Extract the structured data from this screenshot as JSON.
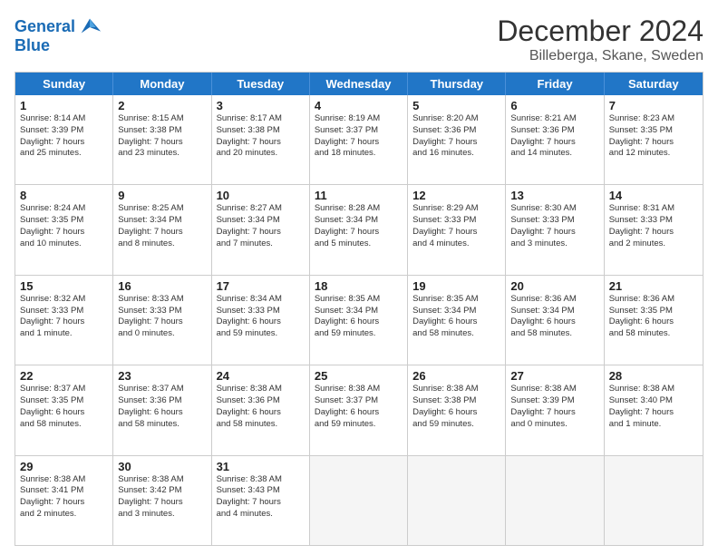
{
  "header": {
    "logo_line1": "General",
    "logo_line2": "Blue",
    "month_title": "December 2024",
    "subtitle": "Billeberga, Skane, Sweden"
  },
  "days_of_week": [
    "Sunday",
    "Monday",
    "Tuesday",
    "Wednesday",
    "Thursday",
    "Friday",
    "Saturday"
  ],
  "weeks": [
    [
      {
        "day": "1",
        "lines": [
          "Sunrise: 8:14 AM",
          "Sunset: 3:39 PM",
          "Daylight: 7 hours",
          "and 25 minutes."
        ]
      },
      {
        "day": "2",
        "lines": [
          "Sunrise: 8:15 AM",
          "Sunset: 3:38 PM",
          "Daylight: 7 hours",
          "and 23 minutes."
        ]
      },
      {
        "day": "3",
        "lines": [
          "Sunrise: 8:17 AM",
          "Sunset: 3:38 PM",
          "Daylight: 7 hours",
          "and 20 minutes."
        ]
      },
      {
        "day": "4",
        "lines": [
          "Sunrise: 8:19 AM",
          "Sunset: 3:37 PM",
          "Daylight: 7 hours",
          "and 18 minutes."
        ]
      },
      {
        "day": "5",
        "lines": [
          "Sunrise: 8:20 AM",
          "Sunset: 3:36 PM",
          "Daylight: 7 hours",
          "and 16 minutes."
        ]
      },
      {
        "day": "6",
        "lines": [
          "Sunrise: 8:21 AM",
          "Sunset: 3:36 PM",
          "Daylight: 7 hours",
          "and 14 minutes."
        ]
      },
      {
        "day": "7",
        "lines": [
          "Sunrise: 8:23 AM",
          "Sunset: 3:35 PM",
          "Daylight: 7 hours",
          "and 12 minutes."
        ]
      }
    ],
    [
      {
        "day": "8",
        "lines": [
          "Sunrise: 8:24 AM",
          "Sunset: 3:35 PM",
          "Daylight: 7 hours",
          "and 10 minutes."
        ]
      },
      {
        "day": "9",
        "lines": [
          "Sunrise: 8:25 AM",
          "Sunset: 3:34 PM",
          "Daylight: 7 hours",
          "and 8 minutes."
        ]
      },
      {
        "day": "10",
        "lines": [
          "Sunrise: 8:27 AM",
          "Sunset: 3:34 PM",
          "Daylight: 7 hours",
          "and 7 minutes."
        ]
      },
      {
        "day": "11",
        "lines": [
          "Sunrise: 8:28 AM",
          "Sunset: 3:34 PM",
          "Daylight: 7 hours",
          "and 5 minutes."
        ]
      },
      {
        "day": "12",
        "lines": [
          "Sunrise: 8:29 AM",
          "Sunset: 3:33 PM",
          "Daylight: 7 hours",
          "and 4 minutes."
        ]
      },
      {
        "day": "13",
        "lines": [
          "Sunrise: 8:30 AM",
          "Sunset: 3:33 PM",
          "Daylight: 7 hours",
          "and 3 minutes."
        ]
      },
      {
        "day": "14",
        "lines": [
          "Sunrise: 8:31 AM",
          "Sunset: 3:33 PM",
          "Daylight: 7 hours",
          "and 2 minutes."
        ]
      }
    ],
    [
      {
        "day": "15",
        "lines": [
          "Sunrise: 8:32 AM",
          "Sunset: 3:33 PM",
          "Daylight: 7 hours",
          "and 1 minute."
        ]
      },
      {
        "day": "16",
        "lines": [
          "Sunrise: 8:33 AM",
          "Sunset: 3:33 PM",
          "Daylight: 7 hours",
          "and 0 minutes."
        ]
      },
      {
        "day": "17",
        "lines": [
          "Sunrise: 8:34 AM",
          "Sunset: 3:33 PM",
          "Daylight: 6 hours",
          "and 59 minutes."
        ]
      },
      {
        "day": "18",
        "lines": [
          "Sunrise: 8:35 AM",
          "Sunset: 3:34 PM",
          "Daylight: 6 hours",
          "and 59 minutes."
        ]
      },
      {
        "day": "19",
        "lines": [
          "Sunrise: 8:35 AM",
          "Sunset: 3:34 PM",
          "Daylight: 6 hours",
          "and 58 minutes."
        ]
      },
      {
        "day": "20",
        "lines": [
          "Sunrise: 8:36 AM",
          "Sunset: 3:34 PM",
          "Daylight: 6 hours",
          "and 58 minutes."
        ]
      },
      {
        "day": "21",
        "lines": [
          "Sunrise: 8:36 AM",
          "Sunset: 3:35 PM",
          "Daylight: 6 hours",
          "and 58 minutes."
        ]
      }
    ],
    [
      {
        "day": "22",
        "lines": [
          "Sunrise: 8:37 AM",
          "Sunset: 3:35 PM",
          "Daylight: 6 hours",
          "and 58 minutes."
        ]
      },
      {
        "day": "23",
        "lines": [
          "Sunrise: 8:37 AM",
          "Sunset: 3:36 PM",
          "Daylight: 6 hours",
          "and 58 minutes."
        ]
      },
      {
        "day": "24",
        "lines": [
          "Sunrise: 8:38 AM",
          "Sunset: 3:36 PM",
          "Daylight: 6 hours",
          "and 58 minutes."
        ]
      },
      {
        "day": "25",
        "lines": [
          "Sunrise: 8:38 AM",
          "Sunset: 3:37 PM",
          "Daylight: 6 hours",
          "and 59 minutes."
        ]
      },
      {
        "day": "26",
        "lines": [
          "Sunrise: 8:38 AM",
          "Sunset: 3:38 PM",
          "Daylight: 6 hours",
          "and 59 minutes."
        ]
      },
      {
        "day": "27",
        "lines": [
          "Sunrise: 8:38 AM",
          "Sunset: 3:39 PM",
          "Daylight: 7 hours",
          "and 0 minutes."
        ]
      },
      {
        "day": "28",
        "lines": [
          "Sunrise: 8:38 AM",
          "Sunset: 3:40 PM",
          "Daylight: 7 hours",
          "and 1 minute."
        ]
      }
    ],
    [
      {
        "day": "29",
        "lines": [
          "Sunrise: 8:38 AM",
          "Sunset: 3:41 PM",
          "Daylight: 7 hours",
          "and 2 minutes."
        ]
      },
      {
        "day": "30",
        "lines": [
          "Sunrise: 8:38 AM",
          "Sunset: 3:42 PM",
          "Daylight: 7 hours",
          "and 3 minutes."
        ]
      },
      {
        "day": "31",
        "lines": [
          "Sunrise: 8:38 AM",
          "Sunset: 3:43 PM",
          "Daylight: 7 hours",
          "and 4 minutes."
        ]
      },
      {
        "day": "",
        "lines": []
      },
      {
        "day": "",
        "lines": []
      },
      {
        "day": "",
        "lines": []
      },
      {
        "day": "",
        "lines": []
      }
    ]
  ]
}
